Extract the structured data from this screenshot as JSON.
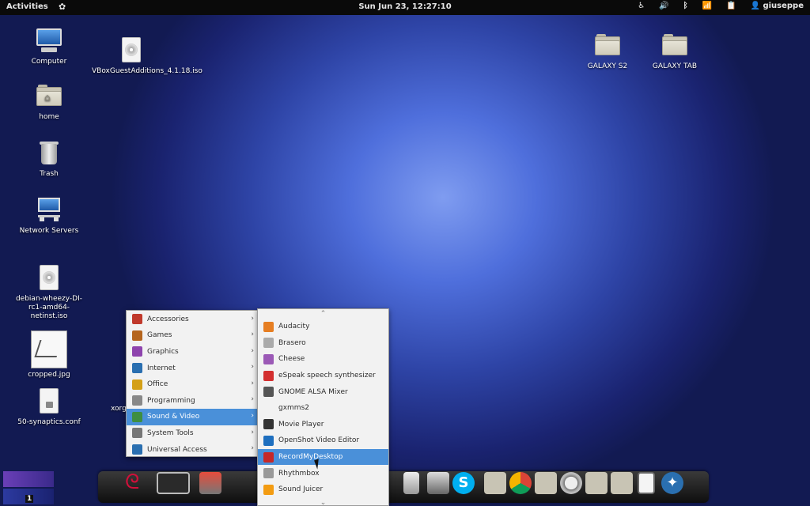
{
  "topbar": {
    "activities": "Activities",
    "clock": "Sun Jun 23, 12:27:10",
    "user": "giuseppe"
  },
  "desktop": {
    "icons": [
      {
        "label": "Computer"
      },
      {
        "label": "VBoxGuestAdditions_4.1.18.iso"
      },
      {
        "label": "home"
      },
      {
        "label": "Trash"
      },
      {
        "label": "Network Servers"
      },
      {
        "label": "debian-wheezy-DI-rc1-amd64-netinst.iso"
      },
      {
        "label": "cropped.jpg"
      },
      {
        "label": "50-synaptics.conf"
      },
      {
        "label": "GALAXY S2"
      },
      {
        "label": "GALAXY TAB"
      }
    ],
    "xorg_label": "xorg"
  },
  "menu": {
    "categories": [
      {
        "label": "Accessories",
        "color": "#c0392b"
      },
      {
        "label": "Games",
        "color": "#b5651d"
      },
      {
        "label": "Graphics",
        "color": "#8e44ad"
      },
      {
        "label": "Internet",
        "color": "#2a6fb0"
      },
      {
        "label": "Office",
        "color": "#d4a017"
      },
      {
        "label": "Programming",
        "color": "#888888"
      },
      {
        "label": "Sound & Video",
        "color": "#3e8e41"
      },
      {
        "label": "System Tools",
        "color": "#777777"
      },
      {
        "label": "Universal Access",
        "color": "#2a6fb0"
      }
    ],
    "selected_category": "Sound & Video",
    "apps": [
      {
        "label": "Audacity",
        "color": "#e67e22"
      },
      {
        "label": "Brasero",
        "color": "#aaaaaa"
      },
      {
        "label": "Cheese",
        "color": "#9b59b6"
      },
      {
        "label": "eSpeak speech synthesizer",
        "color": "#d32f2f"
      },
      {
        "label": "GNOME ALSA Mixer",
        "color": "#555555"
      },
      {
        "label": "gxmms2",
        "color": ""
      },
      {
        "label": "Movie Player",
        "color": "#333333"
      },
      {
        "label": "OpenShot Video Editor",
        "color": "#1e6fbf"
      },
      {
        "label": "RecordMyDesktop",
        "color": "#c62828"
      },
      {
        "label": "Rhythmbox",
        "color": "#999999"
      },
      {
        "label": "Sound Juicer",
        "color": "#f39c12"
      }
    ],
    "selected_app": "RecordMyDesktop"
  },
  "workspace": {
    "current": "1"
  },
  "colors": {
    "accent": "#4a90d9",
    "menu_bg": "#f2f2f2",
    "topbar_bg": "#0a0a0a"
  }
}
